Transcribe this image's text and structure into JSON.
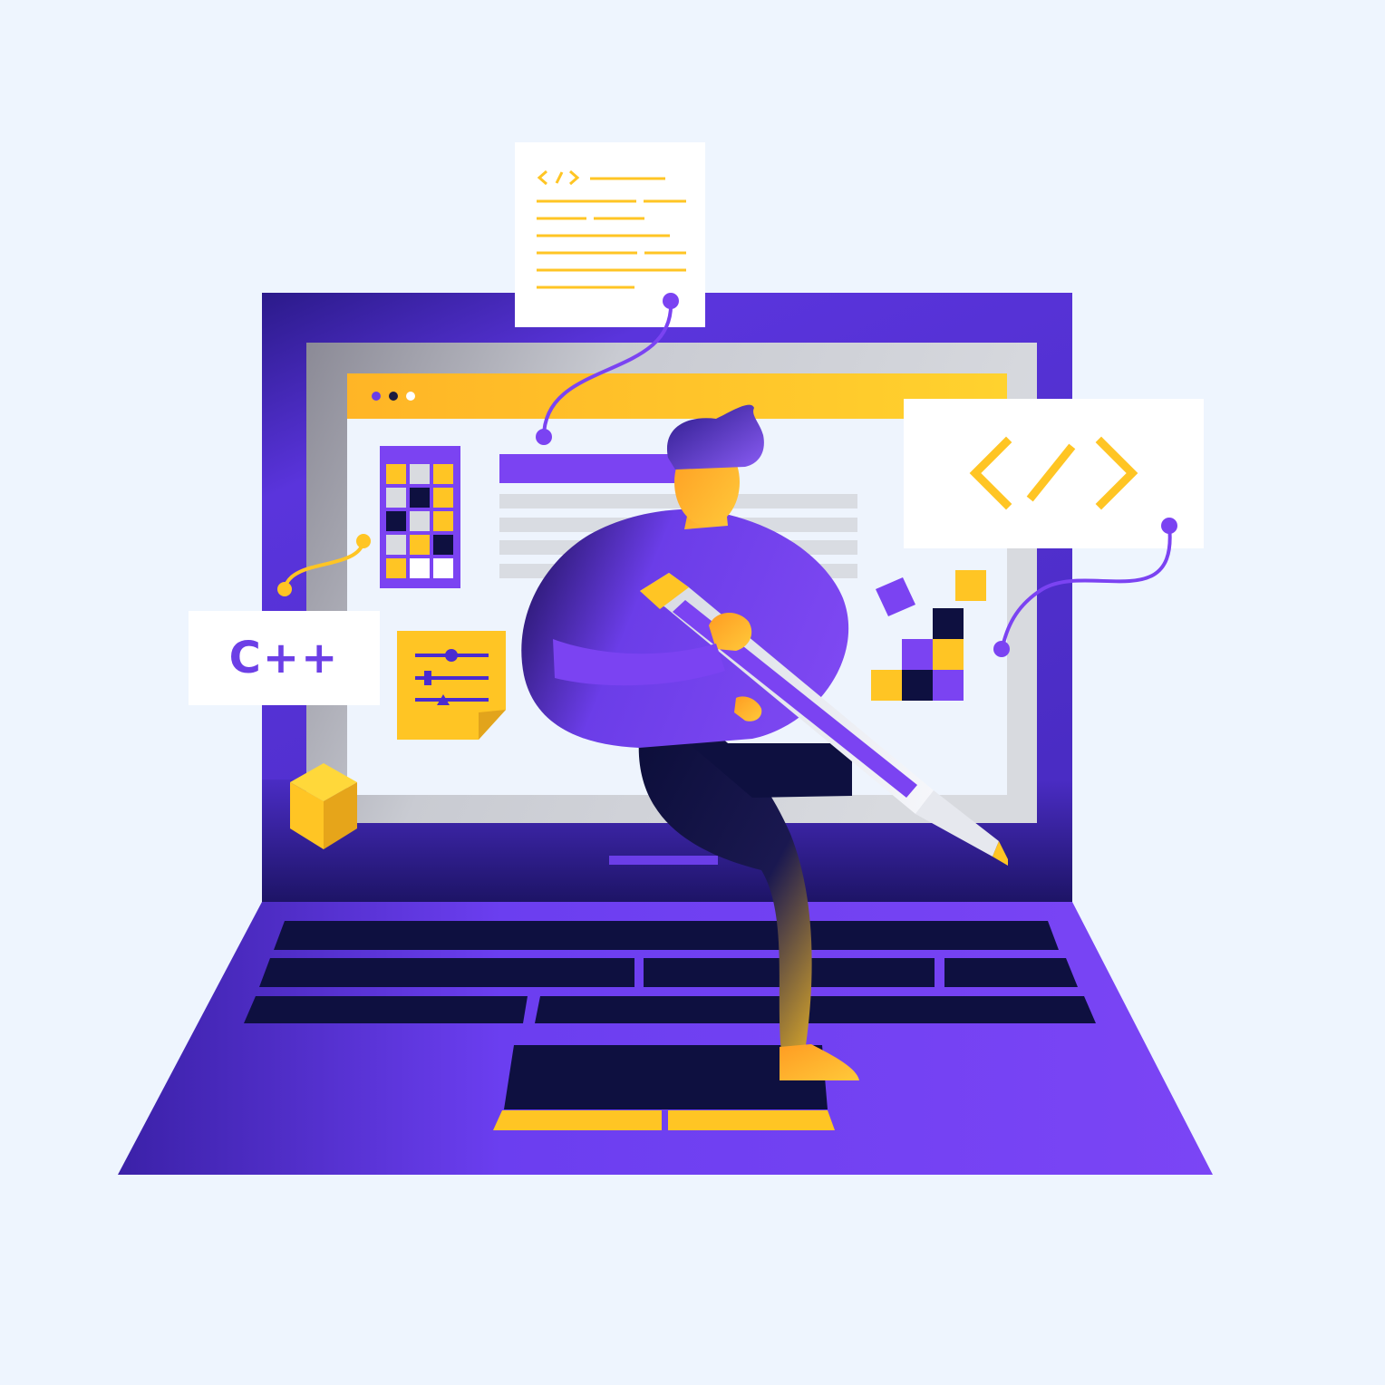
{
  "colors": {
    "background": "#eef5fe",
    "purple": "#7b43f2",
    "deep_purple": "#3a1f9e",
    "navy": "#0e1040",
    "yellow": "#ffc524",
    "white": "#ffffff",
    "screen_light": "#eef4fd",
    "screen_gray": "#cfd2d8",
    "skin": "#ffb52a"
  },
  "cards": {
    "cpp_label": "C++"
  },
  "icons": {
    "code_brackets": "code-brackets-icon",
    "sliders": "sliders-icon",
    "cube": "cube-icon",
    "window_dots": "window-dots-icon"
  }
}
